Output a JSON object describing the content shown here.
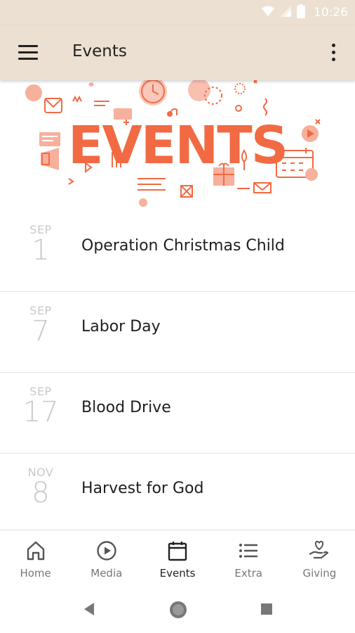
{
  "status_bar": {
    "time": "10:26",
    "icons": [
      "wifi-icon",
      "signal-icon",
      "battery-icon"
    ]
  },
  "app_bar": {
    "title": "Events",
    "menu_icon": "hamburger-menu-icon",
    "overflow_icon": "more-vert-icon"
  },
  "banner": {
    "text": "EVENTS",
    "accent_color": "#f26a43",
    "light_color": "#f7b09c"
  },
  "events": [
    {
      "month": "SEP",
      "day": "1",
      "title": "Operation Christmas Child"
    },
    {
      "month": "SEP",
      "day": "7",
      "title": "Labor Day"
    },
    {
      "month": "SEP",
      "day": "17",
      "title": "Blood Drive"
    },
    {
      "month": "NOV",
      "day": "8",
      "title": "Harvest for God"
    }
  ],
  "bottom_nav": [
    {
      "label": "Home",
      "icon": "home-icon",
      "active": false
    },
    {
      "label": "Media",
      "icon": "play-circle-icon",
      "active": false
    },
    {
      "label": "Events",
      "icon": "calendar-icon",
      "active": true
    },
    {
      "label": "Extra",
      "icon": "list-icon",
      "active": false
    },
    {
      "label": "Giving",
      "icon": "giving-hand-icon",
      "active": false
    }
  ],
  "system_nav": {
    "icons": [
      "back-icon",
      "home-circle-icon",
      "recents-icon"
    ]
  },
  "colors": {
    "header_bg": "#ebe0d1",
    "accent": "#f26a43",
    "date_text": "#c9c9c9"
  }
}
